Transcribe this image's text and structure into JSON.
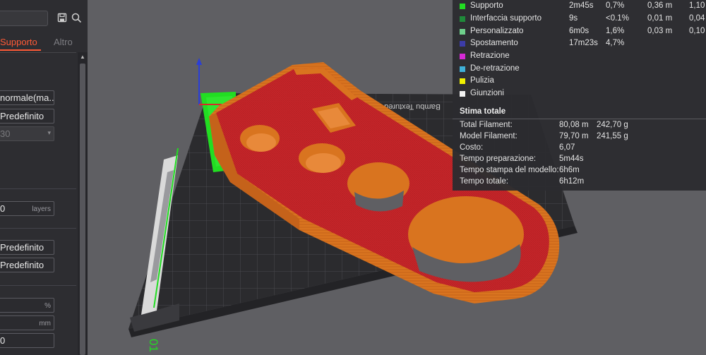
{
  "left_panel": {
    "tabs": [
      {
        "label": "Supporto",
        "active": true
      },
      {
        "label": "Altro",
        "active": false
      }
    ],
    "fields": {
      "support_type": "normale(ma...",
      "style_1": "Predefinito",
      "threshold_angle": "30",
      "layers_value": "0",
      "layers_unit": "layers",
      "pattern_1": "Predefinito",
      "pattern_2": "Predefinito",
      "percent_unit": "%",
      "mm_unit": "mm",
      "bottom_value": "0"
    }
  },
  "viewport": {
    "plate_label": "Bambu Textured PEI Plate",
    "plate_number": "01"
  },
  "stats": {
    "legend": [
      {
        "name": "Supporto",
        "time": "2m45s",
        "pct": "0,7%",
        "length": "0,36 m",
        "weight": "1,10",
        "color": "#22dd22"
      },
      {
        "name": "Interfaccia supporto",
        "time": "9s",
        "pct": "<0.1%",
        "length": "0,01 m",
        "weight": "0,04",
        "color": "#1f8a3a"
      },
      {
        "name": "Personalizzato",
        "time": "6m0s",
        "pct": "1,6%",
        "length": "0,03 m",
        "weight": "0,10",
        "color": "#6fd08c"
      },
      {
        "name": "Spostamento",
        "time": "17m23s",
        "pct": "4,7%",
        "length": "",
        "weight": "",
        "color": "#3c3ca8"
      },
      {
        "name": "Retrazione",
        "time": "",
        "pct": "",
        "length": "",
        "weight": "",
        "color": "#d62ad6"
      },
      {
        "name": "De-retrazione",
        "time": "",
        "pct": "",
        "length": "",
        "weight": "",
        "color": "#3fb0d8"
      },
      {
        "name": "Pulizia",
        "time": "",
        "pct": "",
        "length": "",
        "weight": "",
        "color": "#f0f000"
      },
      {
        "name": "Giunzioni",
        "time": "",
        "pct": "",
        "length": "",
        "weight": "",
        "color": "#f2f2f2"
      }
    ],
    "summary_title": "Stima totale",
    "summary": [
      {
        "label": "Total Filament:",
        "v1": "80,08 m",
        "v2": "242,70 g"
      },
      {
        "label": "Model Filament:",
        "v1": "79,70 m",
        "v2": "241,55 g"
      },
      {
        "label": "Costo:",
        "v1": "6,07",
        "v2": ""
      },
      {
        "label": "Tempo preparazione:",
        "v1": "5m44s",
        "v2": ""
      },
      {
        "label": "Tempo stampa del modello:",
        "v1": "6h6m",
        "v2": ""
      },
      {
        "label": "Tempo totale:",
        "v1": "6h12m",
        "v2": ""
      }
    ]
  },
  "icons": {
    "save": "save-icon",
    "search": "search-icon"
  },
  "colors": {
    "accent": "#ff5a36",
    "model_wall": "#d9741f",
    "model_top": "#c7262a",
    "support": "#22dd22",
    "plate": "#2b2b2e"
  }
}
